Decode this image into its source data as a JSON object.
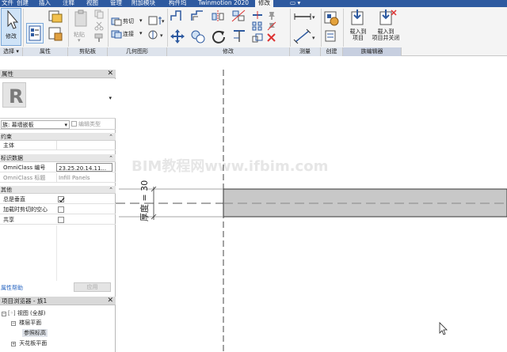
{
  "menu": {
    "tabs": [
      "文件",
      "创建",
      "插入",
      "注释",
      "视图",
      "管理",
      "附加模块",
      "构件坞",
      "Twinmotion 2020",
      "修改"
    ],
    "active_tab": "修改"
  },
  "ribbon": {
    "modify_label": "修改",
    "select_label": "选择 ▾",
    "properties_label": "属性",
    "paste_label": "粘贴",
    "clipboard_label": "剪贴板",
    "cut_label": "剪切",
    "join_label": "连接",
    "geometry_label": "几何图形",
    "modify_panel_label": "修改",
    "measure_label": "测量",
    "create_label": "创建",
    "family_editor_label": "族编辑器",
    "load_into_project_label": "载入到\n项目",
    "load_into_project_close_label": "载入到\n项目并关闭"
  },
  "properties": {
    "title": "属性",
    "family_type_label": "族: 幕墙嵌板",
    "edit_type_label": "编辑类型",
    "groups": {
      "constraints": "约束",
      "identity": "标识数据",
      "other": "其他"
    },
    "rows": {
      "host": "主体",
      "omniclass_number_key": "OmniClass 编号",
      "omniclass_number_value": "23.25.20.14.11...",
      "omniclass_title_key": "OmniClass 标题",
      "omniclass_title_value": "Infill Panels",
      "always_vertical": "总是垂直",
      "cut_with_voids": "加载时剪切的空心",
      "shared": "共享"
    },
    "help_link": "属性帮助",
    "apply_button": "应用"
  },
  "browser": {
    "title": "项目浏览器 - 族1",
    "items": [
      "视图 (全部)",
      "楼层平面",
      "参照标高",
      "天花板平面"
    ]
  },
  "canvas": {
    "dimension_text": "厚度 = 30",
    "watermark": "BIM教程网www.ifbim.com"
  },
  "colors": {
    "menubar": "#2e5aa0",
    "panel_fill": "#c8c8c8",
    "watermark": "#e4e4e4"
  }
}
